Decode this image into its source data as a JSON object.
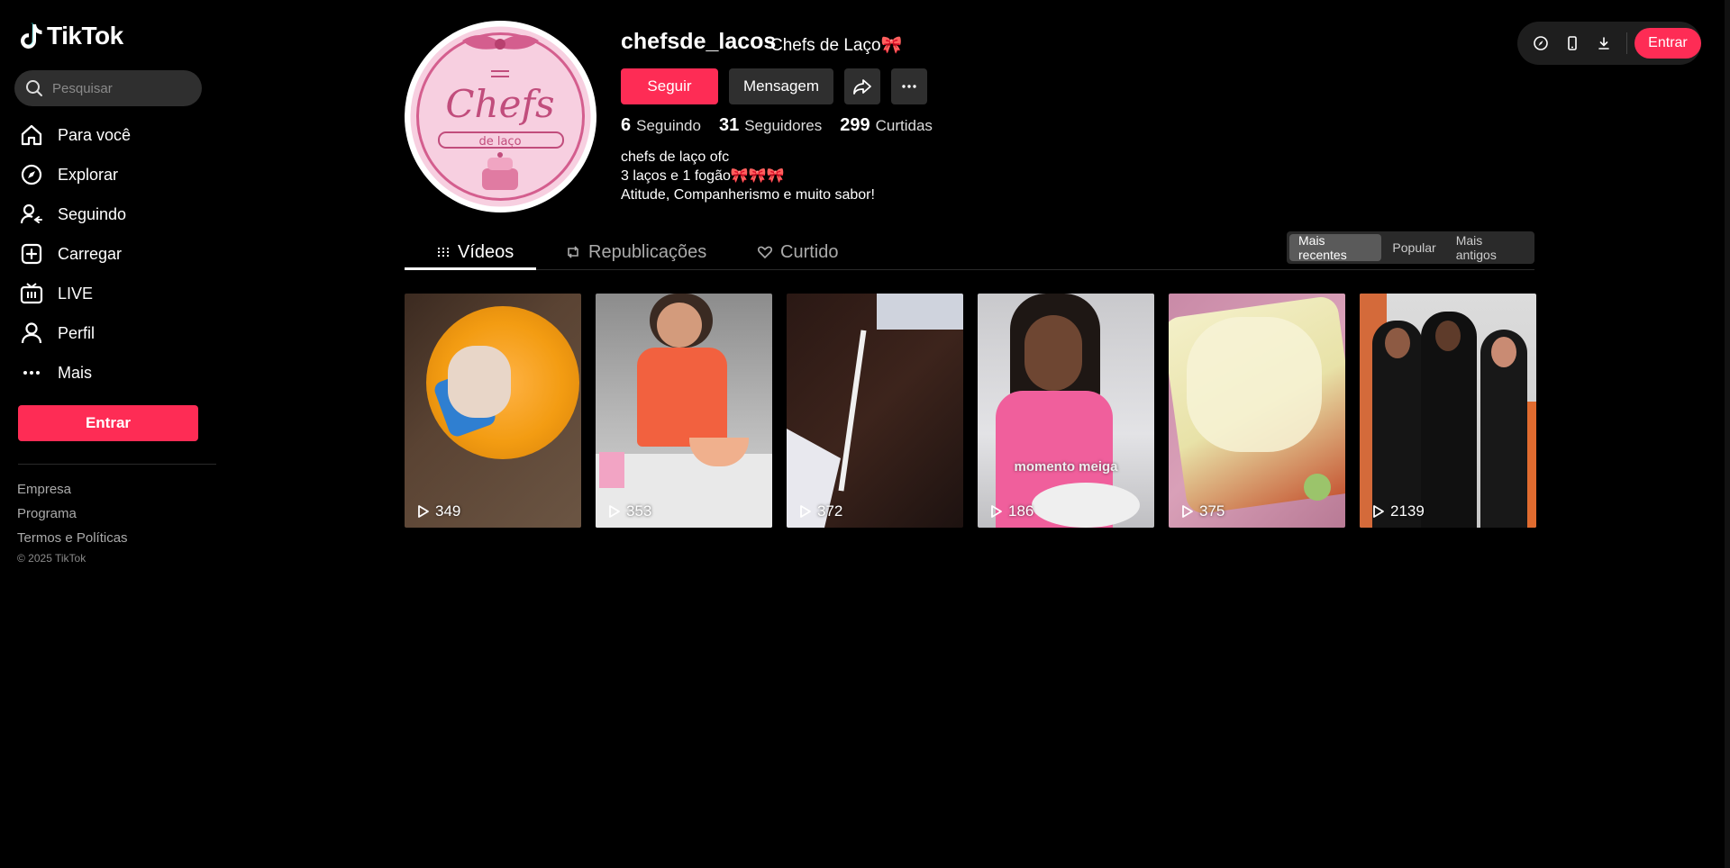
{
  "app": {
    "logo_text": "TikTok"
  },
  "sidebar": {
    "search_placeholder": "Pesquisar",
    "nav": [
      {
        "label": "Para você",
        "icon": "home-icon"
      },
      {
        "label": "Explorar",
        "icon": "compass-icon"
      },
      {
        "label": "Seguindo",
        "icon": "following-icon"
      },
      {
        "label": "Carregar",
        "icon": "upload-icon"
      },
      {
        "label": "LIVE",
        "icon": "live-icon"
      },
      {
        "label": "Perfil",
        "icon": "profile-icon"
      },
      {
        "label": "Mais",
        "icon": "more-icon"
      }
    ],
    "login_label": "Entrar",
    "footer_links": [
      "Empresa",
      "Programa",
      "Termos e Políticas"
    ],
    "copyright": "© 2025 TikTok"
  },
  "profile": {
    "username": "chefsde_lacos",
    "nickname": "Chefs de Laço🎀",
    "follow_label": "Seguir",
    "message_label": "Mensagem",
    "stats": {
      "following": {
        "value": "6",
        "label": "Seguindo"
      },
      "followers": {
        "value": "31",
        "label": "Seguidores"
      },
      "likes": {
        "value": "299",
        "label": "Curtidas"
      }
    },
    "bio": [
      "chefs de laço ofc",
      "3 laços e 1 fogão🎀🎀🎀",
      "Atitude, Companherismo e muito sabor!"
    ],
    "avatar": {
      "title": "Chefs",
      "subtitle": "de laço"
    }
  },
  "tabs": [
    {
      "label": "Vídeos",
      "active": true
    },
    {
      "label": "Republicações",
      "active": false
    },
    {
      "label": "Curtido",
      "active": false
    }
  ],
  "sort": [
    "Mais recentes",
    "Popular",
    "Mais antigos"
  ],
  "videos": [
    {
      "views": "349",
      "overlay": ""
    },
    {
      "views": "353",
      "overlay": ""
    },
    {
      "views": "372",
      "overlay": ""
    },
    {
      "views": "186",
      "overlay": "momento meiga"
    },
    {
      "views": "375",
      "overlay": ""
    },
    {
      "views": "2139",
      "overlay": ""
    }
  ],
  "topbar": {
    "login_label": "Entrar"
  },
  "colors": {
    "accent": "#fe2c55",
    "background": "#000000",
    "button_secondary": "#2f2f2f"
  }
}
